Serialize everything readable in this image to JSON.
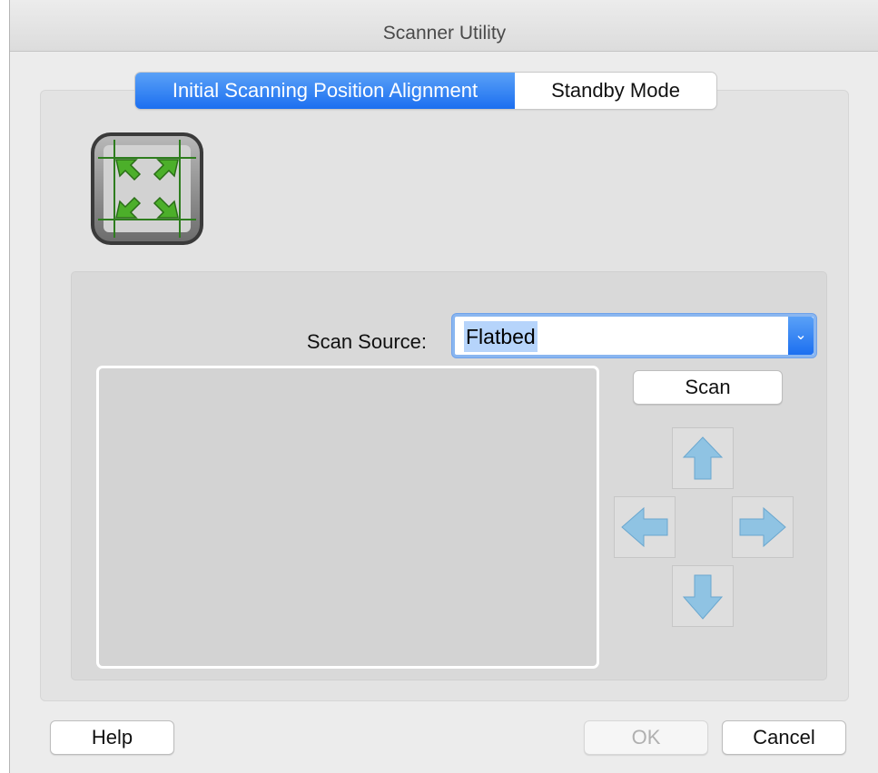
{
  "window": {
    "title": "Scanner Utility"
  },
  "tabs": [
    {
      "label": "Initial Scanning Position Alignment",
      "selected": true
    },
    {
      "label": "Standby Mode",
      "selected": false
    }
  ],
  "icons": {
    "app": "scan-position-alignment-icon",
    "up": "arrow-up-icon",
    "down": "arrow-down-icon",
    "left": "arrow-left-icon",
    "right": "arrow-right-icon",
    "dropdown": "chevron-down-icon"
  },
  "scan_source": {
    "label": "Scan Source:",
    "value": "Flatbed",
    "dropdown_glyph": "⌄"
  },
  "buttons": {
    "scan": "Scan",
    "help": "Help",
    "ok": "OK",
    "cancel": "Cancel"
  },
  "colors": {
    "accent": "#1c6ff0",
    "arrow": "#8fc3e3"
  }
}
